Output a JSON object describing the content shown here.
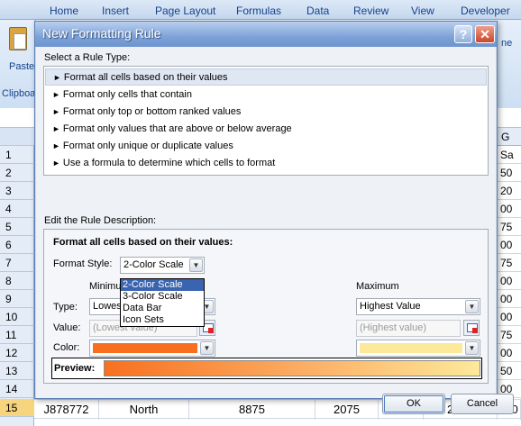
{
  "ribbon": {
    "tabs": [
      "Home",
      "Insert",
      "Page Layout",
      "Formulas",
      "Data",
      "Review",
      "View",
      "Developer"
    ],
    "paste_label": "Paste",
    "clipboard_label": "Clipboa",
    "right_fragment": "ne"
  },
  "sheet": {
    "column_g_header": "G",
    "row_numbers": [
      "1",
      "2",
      "3",
      "4",
      "5",
      "6",
      "7",
      "8",
      "9",
      "10",
      "11",
      "12",
      "13",
      "14",
      "15"
    ],
    "column_g_values": [
      "Sa",
      "50",
      "20",
      "00",
      "75",
      "00",
      "75",
      "00",
      "00",
      "00",
      "75",
      "00",
      "50",
      "00",
      "230"
    ],
    "row_15": [
      "J878772",
      "North",
      "8875",
      "2075",
      "2100",
      "2400"
    ]
  },
  "dialog": {
    "title": "New Formatting Rule",
    "help_glyph": "?",
    "close_glyph": "✕",
    "select_rule_type_label": "Select a Rule Type:",
    "rule_types": [
      "Format all cells based on their values",
      "Format only cells that contain",
      "Format only top or bottom ranked values",
      "Format only values that are above or below average",
      "Format only unique or duplicate values",
      "Use a formula to determine which cells to format"
    ],
    "selected_rule_index": 0,
    "edit_description_label": "Edit the Rule Description:",
    "description_heading": "Format all cells based on their values:",
    "format_style_label": "Format Style:",
    "format_style_value": "2-Color Scale",
    "format_style_options": [
      "2-Color Scale",
      "3-Color Scale",
      "Data Bar",
      "Icon Sets"
    ],
    "minimum_header": "Minimum",
    "maximum_header": "Maximum",
    "type_label": "Type:",
    "value_label": "Value:",
    "color_label": "Color:",
    "min_type_value": "Lowest Value",
    "max_type_value": "Highest Value",
    "min_value_placeholder": "(Lowest value)",
    "max_value_placeholder": "(Highest value)",
    "min_color": "#f8701e",
    "max_color": "#fde99a",
    "preview_label": "Preview:",
    "ok_label": "OK",
    "cancel_label": "Cancel"
  }
}
